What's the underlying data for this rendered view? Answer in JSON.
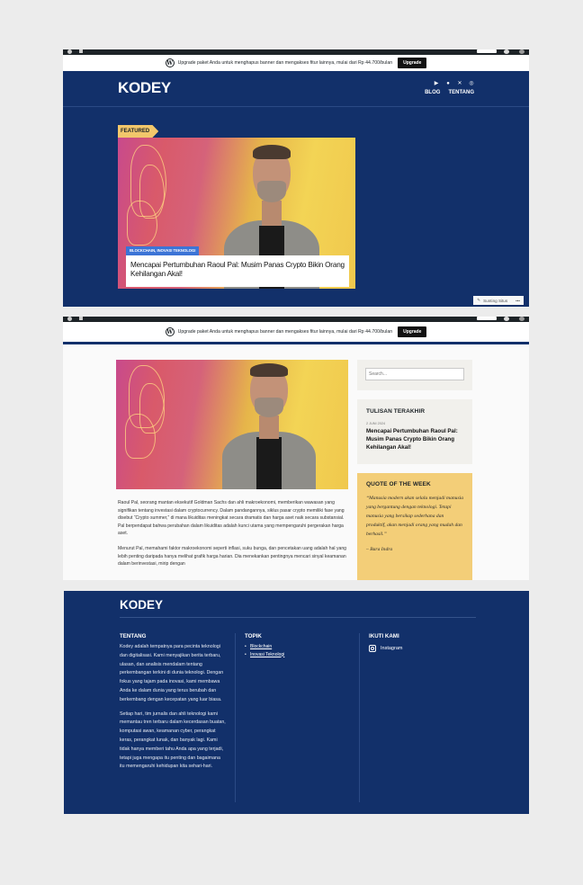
{
  "site": {
    "brand": "KODEY"
  },
  "banner": {
    "text": "Upgrade paket Anda untuk menghapus banner dan mengakses fitur lainnya, mulai dari Rp 44.700/bulan",
    "button": "Upgrade"
  },
  "header": {
    "social_icons": [
      "youtube-icon",
      "facebook-icon",
      "x-icon",
      "instagram-icon"
    ],
    "nav": [
      "BLOG",
      "TENTANG"
    ]
  },
  "featured": {
    "tag": "FEATURED",
    "category": "BLOCKCHAIN, INOVASI TEKNOLOGI",
    "title": "Mencapai Pertumbuhan Raoul Pal: Musim Panas Crypto Bikin Orang Kehilangan Akal!"
  },
  "trending": {
    "label": "Sunting Situs"
  },
  "article": {
    "paragraphs": [
      "Raoul Pal, seorang mantan eksekutif Goldman Sachs dan ahli makroekonomi, memberikan wawasan yang signifikan tentang investasi dalam cryptocurrency. Dalam pandangannya, siklus pasar crypto memiliki fase yang disebut “Crypto summer,” di mana likuiditas meningkat secara dramatis dan harga aset naik secara substansial. Pal berpendapat bahwa perubahan dalam likuiditas adalah kunci utama yang mempengaruhi pergerakan harga aset.",
      "Menurut Pal, memahami faktor makroekonomi seperti inflasi, suku bunga, dan pencetakan uang adalah hal yang lebih penting daripada hanya melihat grafik harga harian. Dia menekankan pentingnya mencari sinyal keamanan dalam berinvestasi, mirip dengan"
    ]
  },
  "sidebar": {
    "search_placeholder": "Search...",
    "recent": {
      "heading": "TULISAN TERAKHIR",
      "date": "2 JUNI 2024",
      "title": "Mencapai Pertumbuhan Raoul Pal: Musim Panas Crypto Bikin Orang Kehilangan Akal!"
    },
    "quote": {
      "heading": "QUOTE OF THE WEEK",
      "text": "“Manusia modern akan selalu menjadi manusia yang bergantung dengan teknologi. Tetapi manusia yang bersikap sederhana dan produktif, akan menjadi orang yang mudah dan berhasil.”",
      "author": "– Bara Indra"
    }
  },
  "footer": {
    "brand": "KODEY",
    "about": {
      "heading": "TENTANG",
      "p1": "Kodey adalah tempatnya para pecinta teknologi dan digitalisasi. Kami menyajikan berita terbaru, ulasan, dan analisis mendalam tentang perkembangan terkini di dunia teknologi. Dengan fokus yang tajam pada inovasi, kami membawa Anda ke dalam dunia yang terus berubah dan berkembang dengan kecepatan yang luar biasa.",
      "p2": "Setiap hari, tim jurnalis dan ahli teknologi kami memantau tren terbaru dalam kecerdasan buatan, komputasi awan, keamanan cyber, perangkat keras, perangkat lunak, dan banyak lagi. Kami tidak hanya memberi tahu Anda apa yang terjadi, tetapi juga mengapa itu penting dan bagaimana itu memengaruhi kehidupan kita sehari-hari."
    },
    "topics": {
      "heading": "TOPIK",
      "items": [
        "Blockchain",
        "Inovasi Teknologi"
      ]
    },
    "follow": {
      "heading": "IKUTI KAMI",
      "instagram": "Instagram"
    }
  }
}
